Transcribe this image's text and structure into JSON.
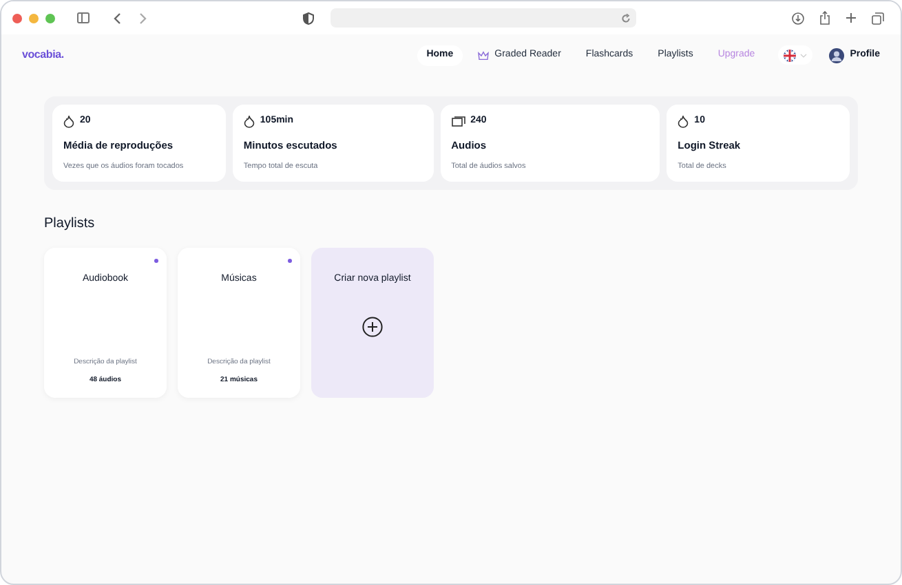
{
  "brand": "vocabia.",
  "nav": [
    {
      "label": "Home",
      "selected": true,
      "kind": "plain"
    },
    {
      "label": "Graded Reader",
      "selected": false,
      "kind": "crown"
    },
    {
      "label": "Flashcards",
      "selected": false,
      "kind": "plain"
    },
    {
      "label": "Playlists",
      "selected": false,
      "kind": "plain"
    },
    {
      "label": "Upgrade",
      "selected": false,
      "kind": "upgrade"
    }
  ],
  "profile": {
    "label": "Profile"
  },
  "stats": [
    {
      "kind": "flame",
      "value": "20",
      "title": "Média de reproduções",
      "caption": "Vezes que os áudios foram tocados"
    },
    {
      "kind": "flame",
      "value": "105min",
      "title": "Minutos escutados",
      "caption": "Tempo total de escuta"
    },
    {
      "kind": "stack",
      "value": "240",
      "title": "Audios",
      "caption": "Total de áudios salvos"
    },
    {
      "kind": "flame",
      "value": "10",
      "title": "Login Streak",
      "caption": "Total de decks"
    }
  ],
  "section_title": "Playlists",
  "playlists": [
    {
      "kind": "playlist",
      "title": "Audiobook",
      "description": "Descrição da playlist",
      "count": "48 áudios",
      "color": "#7c5ce0"
    },
    {
      "kind": "playlist",
      "title": "Músicas",
      "description": "Descrição da playlist",
      "count": "21 músicas",
      "color": "#7c5ce0"
    },
    {
      "kind": "create",
      "title": "Criar nova playlist"
    }
  ]
}
